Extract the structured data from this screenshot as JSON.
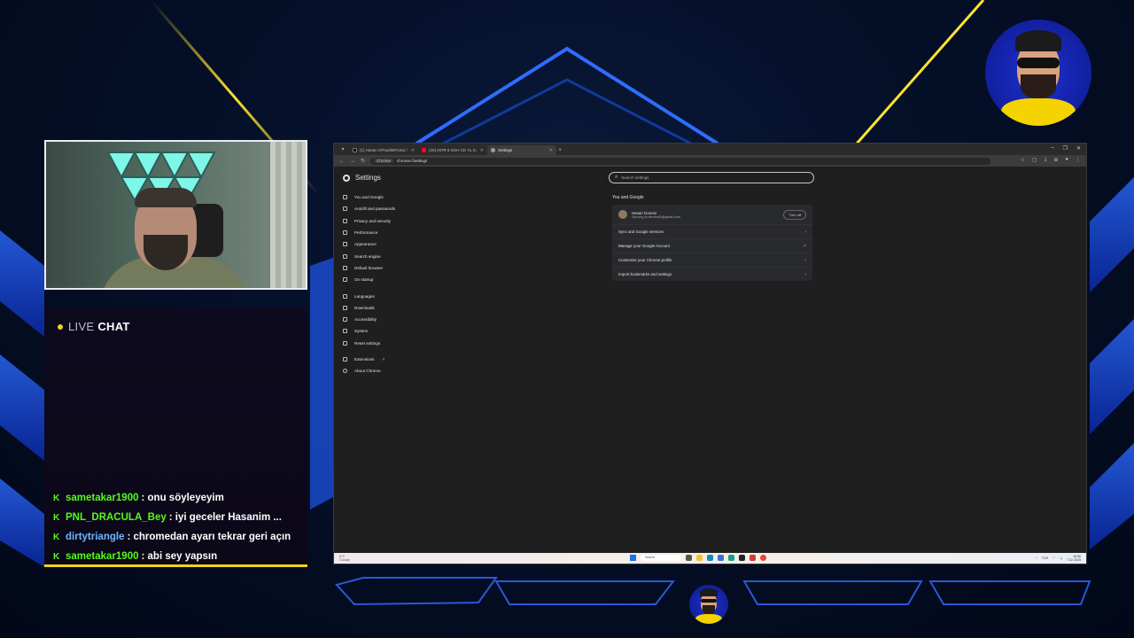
{
  "chat": {
    "live_label": "LIVE",
    "chat_label": "CHAT",
    "messages": [
      {
        "user": "sametakar1900",
        "text": ": onu söyleyeyim",
        "color": "#53fc18"
      },
      {
        "user": "PNL_DRACULA_Bey",
        "text": ": iyi geceler Hasanim ...",
        "color": "#53fc18"
      },
      {
        "user": "dirtytriangle",
        "text": ": chromedan ayarı tekrar geri açın",
        "color": "#6fb6ff"
      },
      {
        "user": "sametakar1900",
        "text": ": abi sey yapsın",
        "color": "#53fc18"
      }
    ]
  },
  "browser": {
    "tabs": [
      {
        "label": "(1) Hasan GPnarli8FGma / X",
        "icon": "x-icon",
        "active": false
      },
      {
        "label": "(20) INTR 8 SOH CE Yu D...",
        "icon": "youtube-icon",
        "active": false
      },
      {
        "label": "Settings",
        "icon": "settings-icon",
        "active": true
      }
    ],
    "new_tab": "+",
    "omnibox_chip": "Chrome",
    "url": "chrome://settings"
  },
  "settings": {
    "title": "Settings",
    "search_placeholder": "Search settings",
    "nav": [
      {
        "label": "You and Google",
        "icon": "google-icon"
      },
      {
        "label": "Autofill and passwords",
        "icon": "autofill-icon"
      },
      {
        "label": "Privacy and security",
        "icon": "shield-icon"
      },
      {
        "label": "Performance",
        "icon": "performance-icon"
      },
      {
        "label": "Appearance",
        "icon": "palette-icon"
      },
      {
        "label": "Search engine",
        "icon": "search-icon"
      },
      {
        "label": "Default browser",
        "icon": "browser-icon"
      },
      {
        "label": "On startup",
        "icon": "power-icon"
      },
      {
        "label": "Languages",
        "icon": "language-icon"
      },
      {
        "label": "Downloads",
        "icon": "download-icon"
      },
      {
        "label": "Accessibility",
        "icon": "accessibility-icon"
      },
      {
        "label": "System",
        "icon": "wrench-icon"
      },
      {
        "label": "Reset settings",
        "icon": "reset-icon"
      },
      {
        "label": "Extensions",
        "icon": "extension-icon"
      },
      {
        "label": "About Chrome",
        "icon": "chrome-icon"
      }
    ],
    "section_title": "You and Google",
    "profile": {
      "name": "Hasan Gunesi",
      "sub": "Syncing to devilm63@gmail.com",
      "turn_off": "Turn off"
    },
    "rows": [
      {
        "label": "Sync and Google services",
        "icon": "chevron-right-icon"
      },
      {
        "label": "Manage your Google Account",
        "icon": "external-link-icon"
      },
      {
        "label": "Customise your Chrome profile",
        "icon": "chevron-right-icon"
      },
      {
        "label": "Import bookmarks and settings",
        "icon": "chevron-right-icon"
      }
    ]
  },
  "taskbar": {
    "weather_temp": "6°C",
    "weather_desc": "Cloudy",
    "search_label": "Search",
    "tray_lang": "TUR",
    "time": "18:56",
    "date": "7.02.2025"
  }
}
